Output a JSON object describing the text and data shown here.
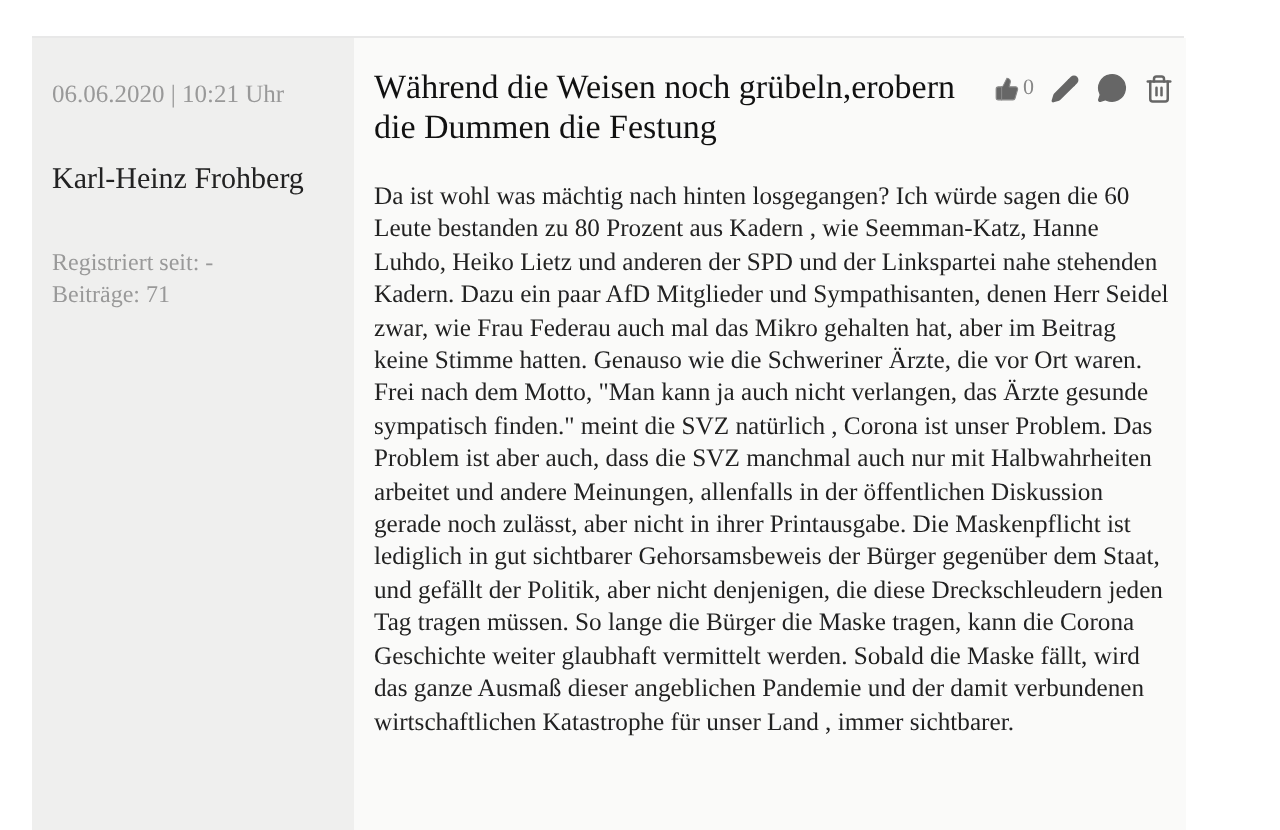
{
  "post": {
    "date": "06.06.2020 | 10:21 Uhr",
    "author": "Karl-Heinz Frohberg",
    "registered": "Registriert seit: -",
    "posts": "Beiträge: 71",
    "title": "Während die Weisen noch grübeln,erobern die Dummen die Festung",
    "likes": "0",
    "body": "Da ist wohl was mächtig nach hinten losgegangen? Ich würde sagen die 60 Leute bestanden zu 80 Prozent aus Kadern , wie Seemman-Katz, Hanne Luhdo, Heiko Lietz und anderen der SPD und der Linkspartei nahe stehenden Kadern. Dazu ein paar AfD Mitglieder und Sympathisanten, denen Herr Seidel zwar, wie Frau Federau auch mal das Mikro gehalten hat, aber im Beitrag keine Stimme hatten. Genauso wie die Schweriner Ärzte, die vor Ort waren. Frei nach dem Motto, \"Man kann ja auch nicht verlangen, das Ärzte gesunde sympatisch finden.\" meint die SVZ natürlich , Corona ist unser Problem. Das Problem ist aber auch, dass die SVZ manchmal auch nur mit Halbwahrheiten arbeitet und andere Meinungen, allenfalls in der öffentlichen Diskussion gerade noch zulässt, aber nicht in ihrer Printausgabe. Die Maskenpflicht ist lediglich in gut sichtbarer Gehorsamsbeweis der Bürger gegenüber dem Staat, und gefällt der Politik, aber nicht denjenigen, die diese Dreckschleudern jeden Tag tragen müssen. So lange die Bürger die Maske tragen, kann die Corona Geschichte weiter glaubhaft vermittelt werden. Sobald die Maske fällt, wird das ganze Ausmaß dieser angeblichen Pandemie und der damit verbundenen wirtschaftlichen Katastrophe für unser Land , immer sichtbarer."
  }
}
